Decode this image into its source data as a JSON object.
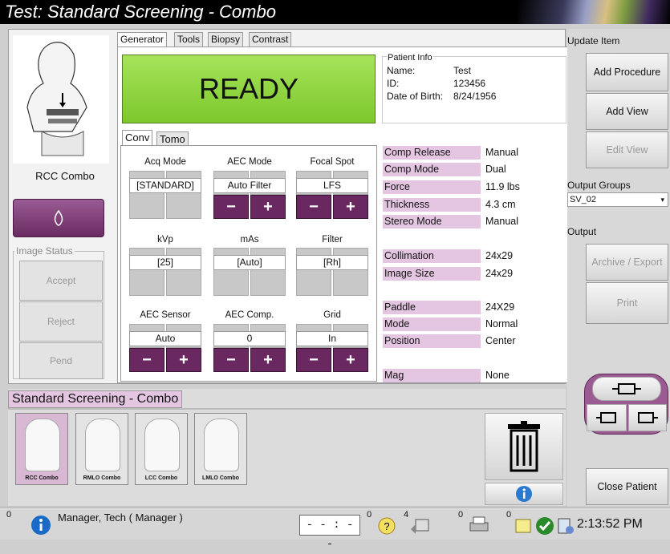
{
  "title": "Test:  Standard Screening - Combo",
  "generator_tabs": [
    "Generator",
    "Tools",
    "Biopsy",
    "Contrast"
  ],
  "ready_text": "READY",
  "patient": {
    "header": "Patient Info",
    "name_label": "Name:",
    "name": "Test",
    "id_label": "ID:",
    "id": "123456",
    "dob_label": "Date of Birth:",
    "dob": "8/24/1956"
  },
  "view_label": "RCC Combo",
  "image_status": {
    "label": "Image Status",
    "accept": "Accept",
    "reject": "Reject",
    "pend": "Pend"
  },
  "mode_tabs": [
    "Conv",
    "Tomo"
  ],
  "controls": {
    "acq_mode": {
      "label": "Acq Mode",
      "value": "[STANDARD]"
    },
    "aec_mode": {
      "label": "AEC Mode",
      "value": "Auto Filter"
    },
    "focal_spot": {
      "label": "Focal Spot",
      "value": "LFS"
    },
    "kvp": {
      "label": "kVp",
      "value": "[25]"
    },
    "mas": {
      "label": "mAs",
      "value": "[Auto]"
    },
    "filter": {
      "label": "Filter",
      "value": "[Rh]"
    },
    "aec_sensor": {
      "label": "AEC Sensor",
      "value": "Auto"
    },
    "aec_comp": {
      "label": "AEC Comp.",
      "value": "0"
    },
    "grid": {
      "label": "Grid",
      "value": "In"
    },
    "minus": "−",
    "plus": "+"
  },
  "status_rows": {
    "comp_release": {
      "label": "Comp Release",
      "value": "Manual"
    },
    "comp_mode": {
      "label": "Comp Mode",
      "value": "Dual"
    },
    "force": {
      "label": "Force",
      "value": "11.9 lbs"
    },
    "thickness": {
      "label": "Thickness",
      "value": "4.3 cm"
    },
    "stereo_mode": {
      "label": "Stereo Mode",
      "value": "Manual"
    },
    "collimation": {
      "label": "Collimation",
      "value": "24x29"
    },
    "image_size": {
      "label": "Image Size",
      "value": "24x29"
    },
    "paddle": {
      "label": "Paddle",
      "value": "24X29"
    },
    "mode": {
      "label": "Mode",
      "value": "Normal"
    },
    "position": {
      "label": "Position",
      "value": "Center"
    },
    "mag": {
      "label": "Mag",
      "value": "None"
    }
  },
  "procedure": {
    "name": "Standard Screening - Combo",
    "views": [
      "RCC Combo",
      "RMLO Combo",
      "LCC Combo",
      "LMLO Combo"
    ]
  },
  "right_panel": {
    "update_item": "Update Item",
    "add_procedure": "Add Procedure",
    "add_view": "Add View",
    "edit_view": "Edit View",
    "output_groups": "Output Groups",
    "output_group_value": "SV_02",
    "output": "Output",
    "archive_export": "Archive / Export",
    "print": "Print",
    "close_patient": "Close Patient"
  },
  "statusbar": {
    "count_left": "0",
    "user": "Manager, Tech ( Manager )",
    "timer": "- - : - -",
    "timer_count": "0",
    "count2": "4",
    "count3": "0",
    "count4": "0",
    "time": "2:13:52 PM"
  },
  "colors": {
    "ready_green": "#8fd43e",
    "accent_purple": "#7a3a72",
    "label_pink": "#e5c6e2"
  }
}
